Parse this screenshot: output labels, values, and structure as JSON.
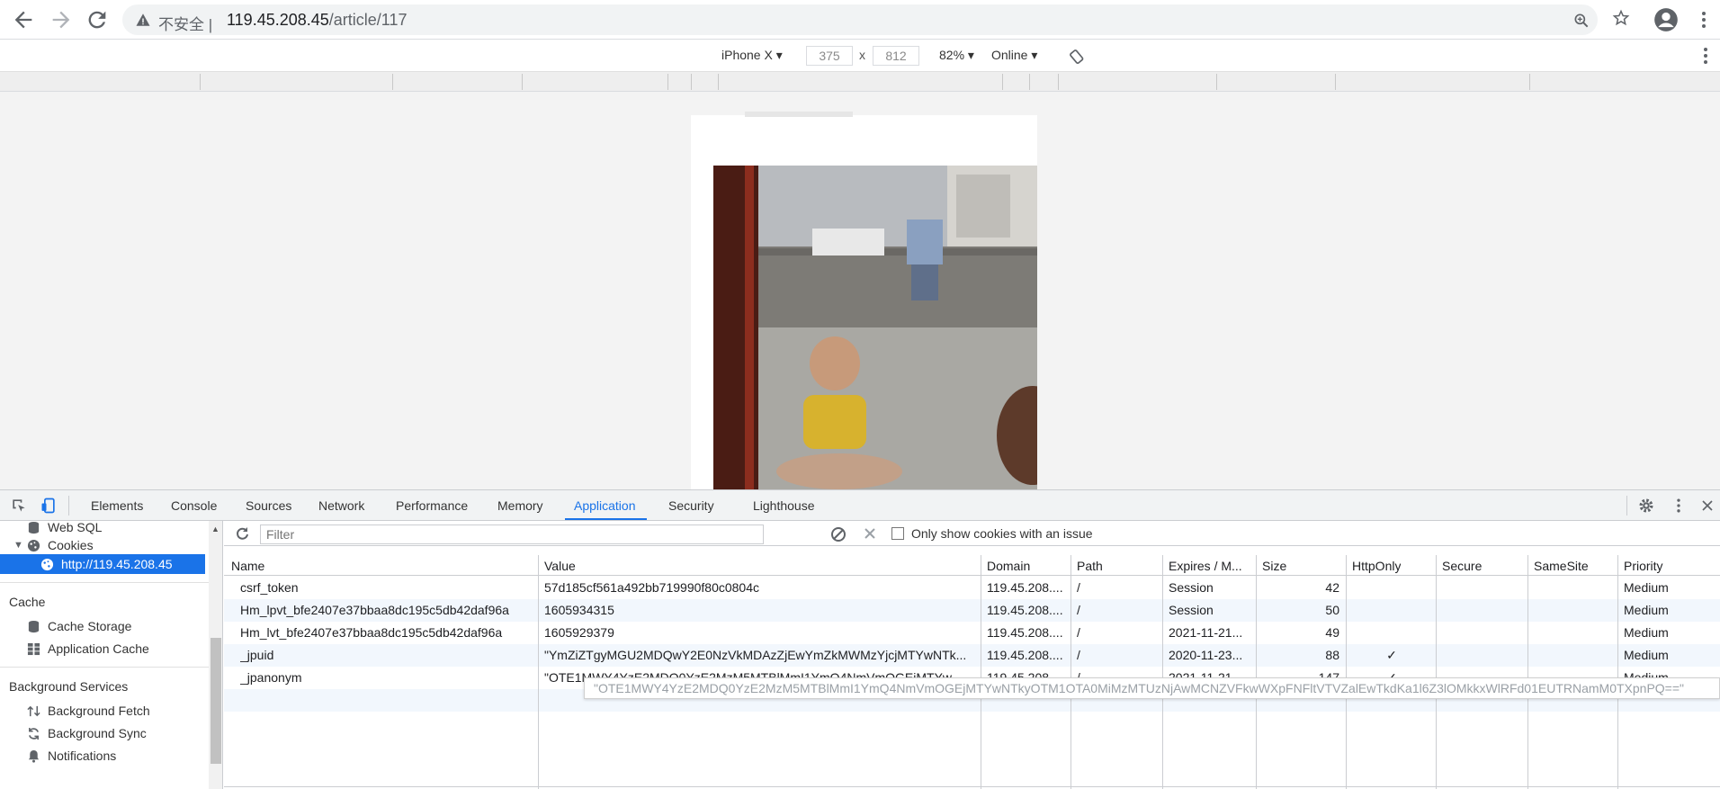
{
  "browser": {
    "security_label": "不安全",
    "url_host": "119.45.208.45",
    "url_path": "/article/117"
  },
  "device_toolbar": {
    "device": "iPhone X",
    "width": "375",
    "height": "812",
    "times": "x",
    "zoom": "82%",
    "throttle": "Online"
  },
  "devtools": {
    "tabs": [
      "Elements",
      "Console",
      "Sources",
      "Network",
      "Performance",
      "Memory",
      "Application",
      "Security",
      "Lighthouse"
    ],
    "active_tab": "Application",
    "sidebar": {
      "web_sql": "Web SQL",
      "cookies": "Cookies",
      "cookie_origin": "http://119.45.208.45",
      "cache_header": "Cache",
      "cache_storage": "Cache Storage",
      "application_cache": "Application Cache",
      "bg_header": "Background Services",
      "bg_fetch": "Background Fetch",
      "bg_sync": "Background Sync",
      "notifications": "Notifications"
    },
    "filter": {
      "placeholder": "Filter",
      "only_issues": "Only show cookies with an issue"
    },
    "columns": [
      "Name",
      "Value",
      "Domain",
      "Path",
      "Expires / M...",
      "Size",
      "HttpOnly",
      "Secure",
      "SameSite",
      "Priority"
    ],
    "rows": [
      {
        "name": "csrf_token",
        "value": "57d185cf561a492bb719990f80c0804c",
        "domain": "119.45.208....",
        "path": "/",
        "expires": "Session",
        "size": "42",
        "httponly": "",
        "secure": "",
        "samesite": "",
        "priority": "Medium"
      },
      {
        "name": "Hm_lpvt_bfe2407e37bbaa8dc195c5db42daf96a",
        "value": "1605934315",
        "domain": "119.45.208....",
        "path": "/",
        "expires": "Session",
        "size": "50",
        "httponly": "",
        "secure": "",
        "samesite": "",
        "priority": "Medium"
      },
      {
        "name": "Hm_lvt_bfe2407e37bbaa8dc195c5db42daf96a",
        "value": "1605929379",
        "domain": "119.45.208....",
        "path": "/",
        "expires": "2021-11-21...",
        "size": "49",
        "httponly": "",
        "secure": "",
        "samesite": "",
        "priority": "Medium"
      },
      {
        "name": "_jpuid",
        "value": "\"YmZiZTgyMGU2MDQwY2E0NzVkMDAzZjEwYmZkMWMzYjcjMTYwNTk...",
        "domain": "119.45.208....",
        "path": "/",
        "expires": "2020-11-23...",
        "size": "88",
        "httponly": "✓",
        "secure": "",
        "samesite": "",
        "priority": "Medium"
      },
      {
        "name": "_jpanonym",
        "value": "\"OTE1MWY4YzE2MDQ0YzE2MzM5MTBlMmI1YmQ4NmVmOGEjMTYw...",
        "domain": "119.45.208....",
        "path": "/",
        "expires": "2021-11-21...",
        "size": "147",
        "httponly": "✓",
        "secure": "",
        "samesite": "",
        "priority": "Medium"
      }
    ],
    "tooltip": "\"OTE1MWY4YzE2MDQ0YzE2MzM5MTBlMmI1YmQ4NmVmOGEjMTYwNTkyOTM1OTA0MiMzMTUzNjAwMCNZVFkwWXpFNFltVTVZalEwTkdKa1l6Z3lOMkkxWlRFd01EUTRNamM0TXpnPQ==\""
  }
}
